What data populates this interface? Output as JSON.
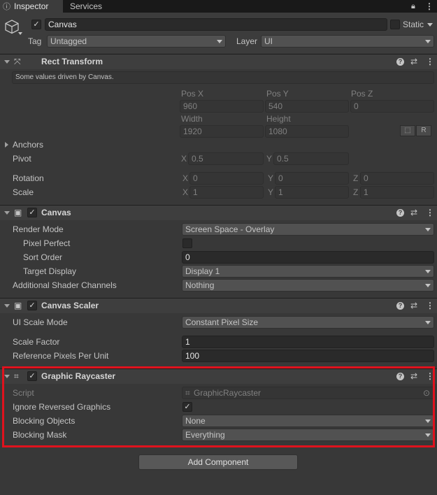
{
  "tabs": {
    "inspector": "Inspector",
    "services": "Services"
  },
  "object": {
    "name": "Canvas",
    "static_label": "Static",
    "tag_label": "Tag",
    "tag_value": "Untagged",
    "layer_label": "Layer",
    "layer_value": "UI"
  },
  "rect_transform": {
    "title": "Rect Transform",
    "note": "Some values driven by Canvas.",
    "pos_x_label": "Pos X",
    "pos_y_label": "Pos Y",
    "pos_z_label": "Pos Z",
    "pos_x": "960",
    "pos_y": "540",
    "pos_z": "0",
    "width_label": "Width",
    "height_label": "Height",
    "width": "1920",
    "height": "1080",
    "r_button": "R",
    "anchors_label": "Anchors",
    "pivot_label": "Pivot",
    "pivot_x_label": "X",
    "pivot_x": "0.5",
    "pivot_y_label": "Y",
    "pivot_y": "0.5",
    "rotation_label": "Rotation",
    "rot_x": "0",
    "rot_y": "0",
    "rot_z": "0",
    "scale_label": "Scale",
    "scale_x": "1",
    "scale_y": "1",
    "scale_z": "1",
    "x": "X",
    "y": "Y",
    "z": "Z"
  },
  "canvas": {
    "title": "Canvas",
    "render_mode_label": "Render Mode",
    "render_mode": "Screen Space - Overlay",
    "pixel_perfect_label": "Pixel Perfect",
    "sort_order_label": "Sort Order",
    "sort_order": "0",
    "target_display_label": "Target Display",
    "target_display": "Display 1",
    "shader_channels_label": "Additional Shader Channels",
    "shader_channels": "Nothing"
  },
  "canvas_scaler": {
    "title": "Canvas Scaler",
    "ui_scale_mode_label": "UI Scale Mode",
    "ui_scale_mode": "Constant Pixel Size",
    "scale_factor_label": "Scale Factor",
    "scale_factor": "1",
    "ref_ppu_label": "Reference Pixels Per Unit",
    "ref_ppu": "100"
  },
  "graphic_raycaster": {
    "title": "Graphic Raycaster",
    "script_label": "Script",
    "script_value": "GraphicRaycaster",
    "ignore_reversed_label": "Ignore Reversed Graphics",
    "blocking_objects_label": "Blocking Objects",
    "blocking_objects": "None",
    "blocking_mask_label": "Blocking Mask",
    "blocking_mask": "Everything"
  },
  "add_component": "Add Component",
  "highlight_color": "#e0121d"
}
